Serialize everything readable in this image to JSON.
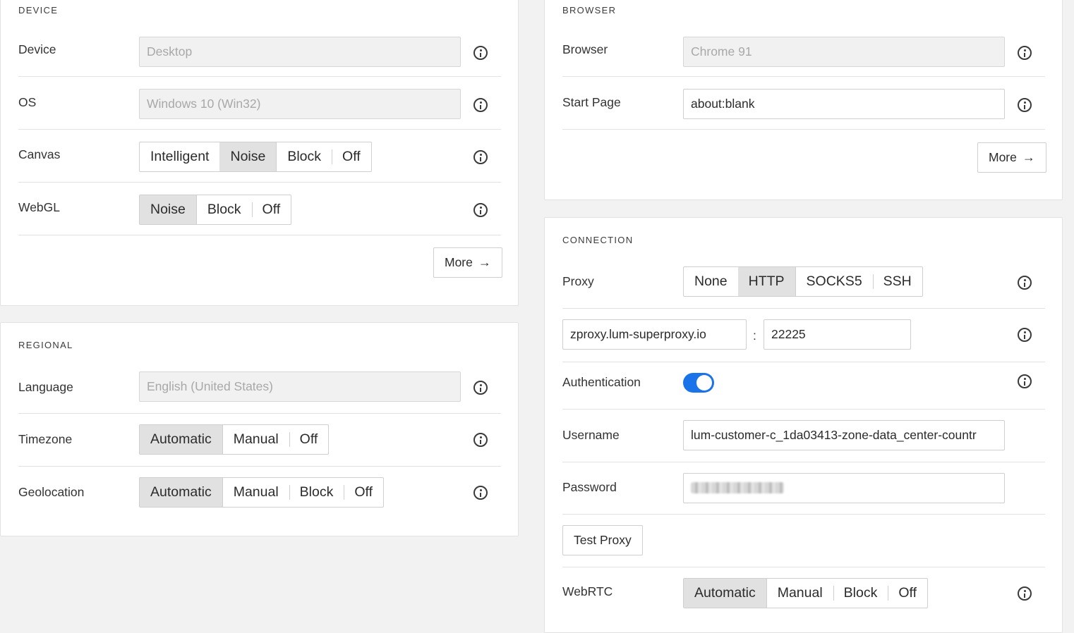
{
  "device": {
    "section_title": "DEVICE",
    "device": {
      "label": "Device",
      "value": "Desktop"
    },
    "os": {
      "label": "OS",
      "value": "Windows 10 (Win32)"
    },
    "canvas": {
      "label": "Canvas",
      "options": [
        "Intelligent",
        "Noise",
        "Block",
        "Off"
      ],
      "selected": "Noise"
    },
    "webgl": {
      "label": "WebGL",
      "options": [
        "Noise",
        "Block",
        "Off"
      ],
      "selected": "Noise"
    },
    "more_label": "More"
  },
  "regional": {
    "section_title": "REGIONAL",
    "language": {
      "label": "Language",
      "value": "English (United States)"
    },
    "timezone": {
      "label": "Timezone",
      "options": [
        "Automatic",
        "Manual",
        "Off"
      ],
      "selected": "Automatic"
    },
    "geolocation": {
      "label": "Geolocation",
      "options": [
        "Automatic",
        "Manual",
        "Block",
        "Off"
      ],
      "selected": "Automatic"
    }
  },
  "browser": {
    "section_title": "BROWSER",
    "browser": {
      "label": "Browser",
      "value": "Chrome 91"
    },
    "start_page": {
      "label": "Start Page",
      "value": "about:blank"
    },
    "more_label": "More"
  },
  "connection": {
    "section_title": "CONNECTION",
    "proxy": {
      "label": "Proxy",
      "options": [
        "None",
        "HTTP",
        "SOCKS5",
        "SSH"
      ],
      "selected": "HTTP"
    },
    "host": "zproxy.lum-superproxy.io",
    "separator": ":",
    "port": "22225",
    "authentication": {
      "label": "Authentication",
      "enabled": true
    },
    "username": {
      "label": "Username",
      "value": "lum-customer-c_1da03413-zone-data_center-countr"
    },
    "password": {
      "label": "Password"
    },
    "test_proxy_label": "Test Proxy",
    "webrtc": {
      "label": "WebRTC",
      "options": [
        "Automatic",
        "Manual",
        "Block",
        "Off"
      ],
      "selected": "Automatic"
    }
  },
  "colors": {
    "toggle_on": "#1a73e8",
    "selected_segment": "#e1e1e1"
  }
}
